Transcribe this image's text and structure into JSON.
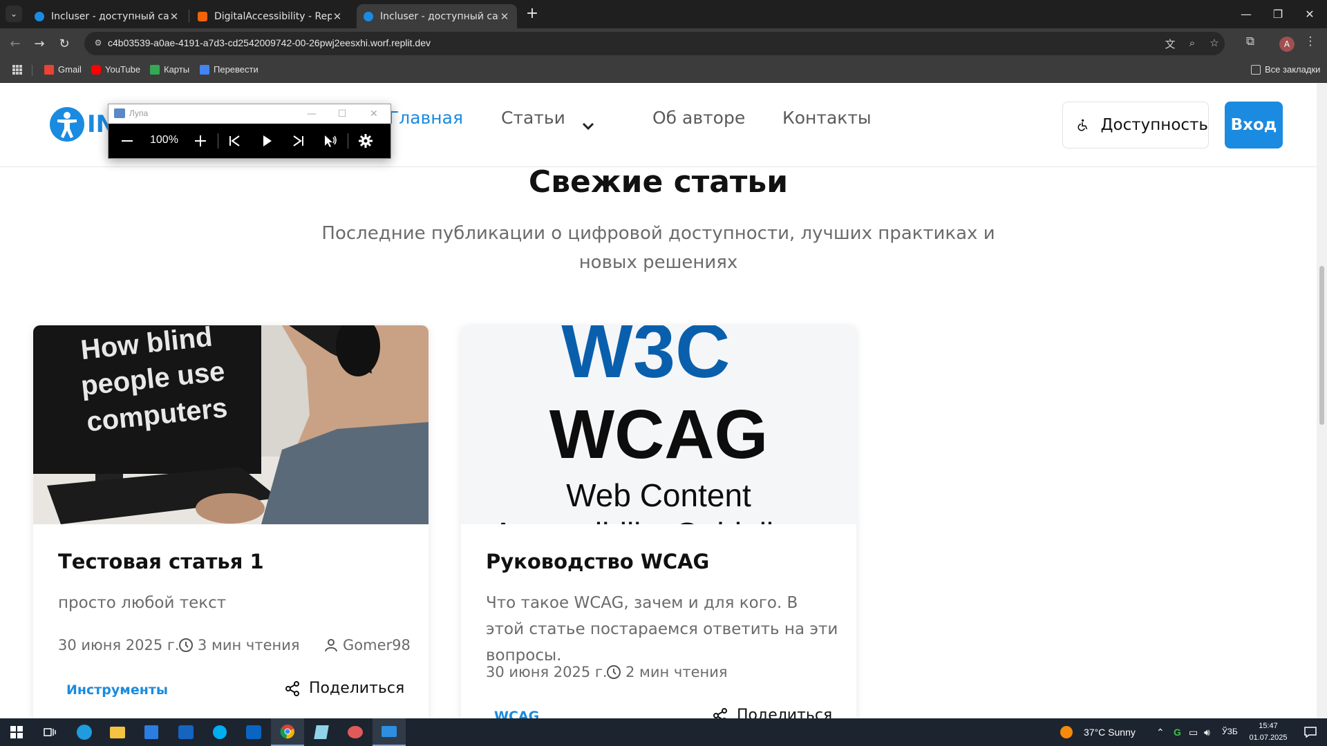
{
  "browser": {
    "tabs": [
      {
        "title": "Incluser - доступный сайт о доступности",
        "active": false
      },
      {
        "title": "DigitalAccessibility - Replit",
        "active": false
      },
      {
        "title": "Incluser - доступный сайт о доступности",
        "active": true
      }
    ],
    "url": "c4b03539-a0ae-4191-a7d3-cd2542009742-00-26pwj2eesxhi.worf.replit.dev",
    "bookmarks": [
      {
        "label": "Gmail",
        "color": "#ea4335"
      },
      {
        "label": "YouTube",
        "color": "#ff0000"
      },
      {
        "label": "Карты",
        "color": "#34a853"
      },
      {
        "label": "Перевести",
        "color": "#4285f4"
      }
    ],
    "all_bookmarks": "Все закладки",
    "profile_initial": "A"
  },
  "site": {
    "logo_text": "INC",
    "nav": {
      "home": "Главная",
      "articles": "Статьи",
      "about": "Об авторе",
      "contacts": "Контакты"
    },
    "accessibility_label": "Доступность",
    "login_label": "Вход",
    "accent_color": "#1a8be0"
  },
  "section": {
    "title": "Свежие статьи",
    "subtitle": "Последние публикации о цифровой доступности, лучших практиках и новых решениях"
  },
  "articles": [
    {
      "image_text": [
        "How blind",
        "people use",
        "computers"
      ],
      "title": "Тестовая статья 1",
      "excerpt": "просто любой текст",
      "date": "30 июня 2025 г.",
      "read_time": "3 мин чтения",
      "author": "Gomer98",
      "tag": "Инструменты",
      "share": "Поделиться"
    },
    {
      "image_text": [
        "W3C",
        "WCAG",
        "Web Content",
        "Accessibility Guidelines"
      ],
      "title": "Руководство WCAG",
      "excerpt": "Что такое WCAG, зачем и для кого. В этой статье постараемся ответить на эти вопросы.",
      "date": "30 июня 2025 г.",
      "read_time": "2 мин чтения",
      "tag": "WCAG",
      "share": "Поделиться"
    }
  ],
  "magnifier": {
    "title": "Лупа",
    "zoom": "100%"
  },
  "taskbar": {
    "weather": "37°C  Sunny",
    "lang": "ЎЗБ",
    "time": "15:47",
    "date": "01.07.2025"
  }
}
